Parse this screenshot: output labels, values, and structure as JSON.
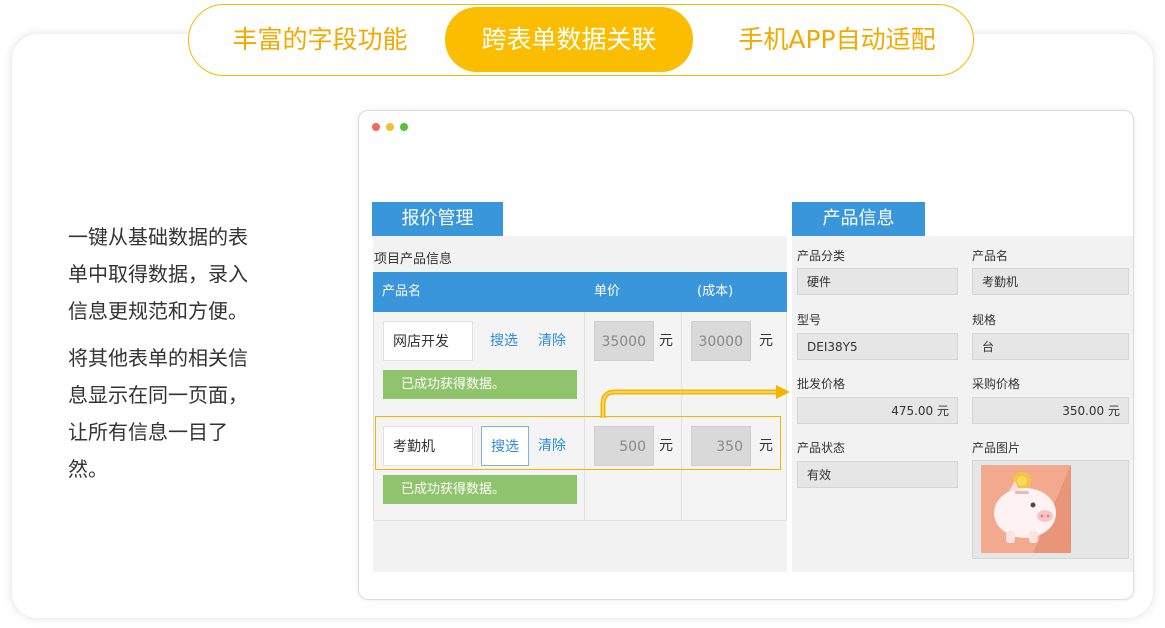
{
  "tabs": [
    {
      "label": "丰富的字段功能"
    },
    {
      "label": "跨表单数据关联"
    },
    {
      "label": "手机APP自动适配"
    }
  ],
  "description": {
    "para1": [
      "一键从基础数据的表",
      "单中取得数据，录入",
      "信息更规范和方便。"
    ],
    "para2": [
      "将其他表单的相关信",
      "息显示在同一页面，",
      "让所有信息一目了",
      "然。"
    ]
  },
  "quote": {
    "title": "报价管理",
    "subtitle": "项目产品信息",
    "columns": [
      "产品名",
      "单价",
      "(成本)"
    ],
    "search_label": "搜选",
    "clear_label": "清除",
    "currency": "元",
    "success": "已成功获得数据。",
    "rows": [
      {
        "name": "网店开发",
        "price": "35000",
        "cost": "30000"
      },
      {
        "name": "考勤机",
        "price": "500",
        "cost": "350"
      }
    ]
  },
  "product": {
    "title": "产品信息",
    "fields": {
      "category": {
        "label": "产品分类",
        "value": "硬件"
      },
      "name": {
        "label": "产品名",
        "value": "考勤机"
      },
      "model": {
        "label": "型号",
        "value": "DEI38Y5"
      },
      "spec": {
        "label": "规格",
        "value": "台"
      },
      "wholesale": {
        "label": "批发价格",
        "value": "475.00 元"
      },
      "purchase": {
        "label": "采购价格",
        "value": "350.00 元"
      },
      "status": {
        "label": "产品状态",
        "value": "有效"
      },
      "image": {
        "label": "产品图片"
      }
    }
  },
  "colors": {
    "accent": "#fbbd00",
    "blue": "#3a96db",
    "success": "#8fc46c"
  }
}
